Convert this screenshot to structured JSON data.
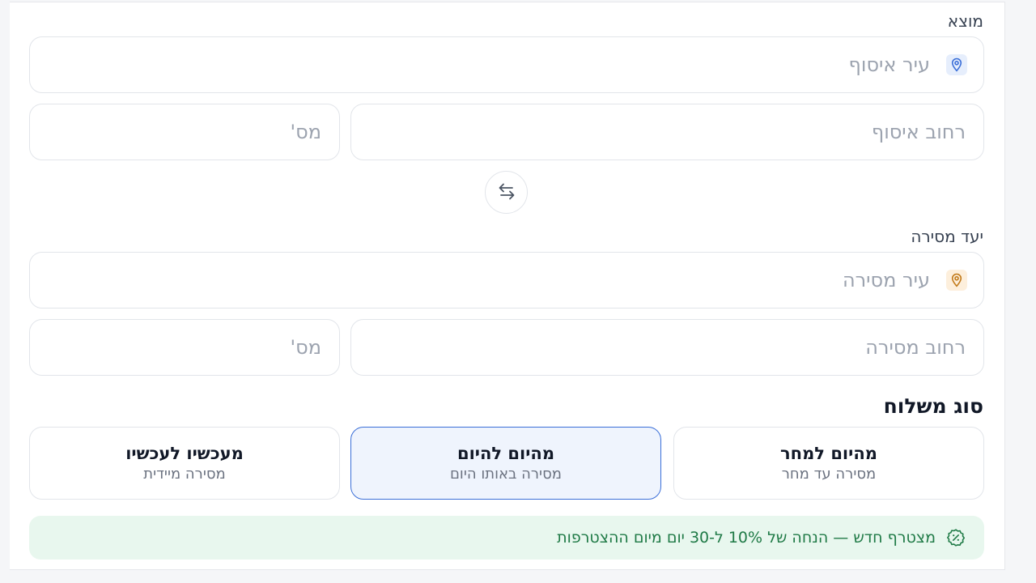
{
  "origin": {
    "label": "מוצא",
    "city_placeholder": "עיר איסוף",
    "street_placeholder": "רחוב איסוף",
    "number_placeholder": "מס'"
  },
  "destination": {
    "label": "יעד מסירה",
    "city_placeholder": "עיר מסירה",
    "street_placeholder": "רחוב מסירה",
    "number_placeholder": "מס'"
  },
  "shipping": {
    "title": "סוג משלוח",
    "options": [
      {
        "title": "מהיום למחר",
        "subtitle": "מסירה עד מחר",
        "selected": false
      },
      {
        "title": "מהיום להיום",
        "subtitle": "מסירה באותו היום",
        "selected": true
      },
      {
        "title": "מעכשיו לעכשיו",
        "subtitle": "מסירה מיידית",
        "selected": false
      }
    ]
  },
  "promo": {
    "text": "מצטרף חדש — הנחה של 10% ל-30 יום מיום ההצטרפות"
  },
  "icons": {
    "origin_pin": "map-pin-icon",
    "destination_pin": "map-pin-icon",
    "swap": "swap-arrows-icon",
    "promo": "discount-badge-icon"
  },
  "colors": {
    "accent": "#3b6fd8",
    "origin_pin": "#3b6fd8",
    "destination_pin": "#c27a1a",
    "promo_bg": "#e8f7ee",
    "promo_text": "#1f7a46"
  }
}
